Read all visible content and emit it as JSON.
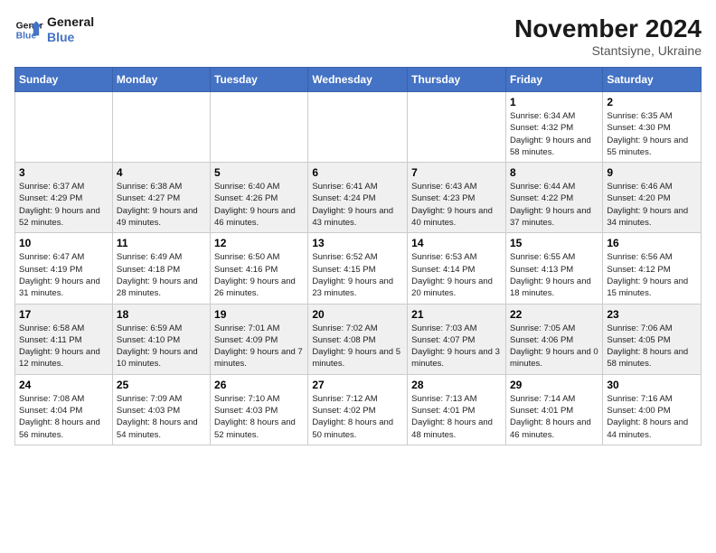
{
  "logo": {
    "line1": "General",
    "line2": "Blue"
  },
  "title": {
    "month_year": "November 2024",
    "location": "Stantsiyne, Ukraine"
  },
  "days_of_week": [
    "Sunday",
    "Monday",
    "Tuesday",
    "Wednesday",
    "Thursday",
    "Friday",
    "Saturday"
  ],
  "weeks": [
    [
      {
        "day": "",
        "info": ""
      },
      {
        "day": "",
        "info": ""
      },
      {
        "day": "",
        "info": ""
      },
      {
        "day": "",
        "info": ""
      },
      {
        "day": "",
        "info": ""
      },
      {
        "day": "1",
        "info": "Sunrise: 6:34 AM\nSunset: 4:32 PM\nDaylight: 9 hours and 58 minutes."
      },
      {
        "day": "2",
        "info": "Sunrise: 6:35 AM\nSunset: 4:30 PM\nDaylight: 9 hours and 55 minutes."
      }
    ],
    [
      {
        "day": "3",
        "info": "Sunrise: 6:37 AM\nSunset: 4:29 PM\nDaylight: 9 hours and 52 minutes."
      },
      {
        "day": "4",
        "info": "Sunrise: 6:38 AM\nSunset: 4:27 PM\nDaylight: 9 hours and 49 minutes."
      },
      {
        "day": "5",
        "info": "Sunrise: 6:40 AM\nSunset: 4:26 PM\nDaylight: 9 hours and 46 minutes."
      },
      {
        "day": "6",
        "info": "Sunrise: 6:41 AM\nSunset: 4:24 PM\nDaylight: 9 hours and 43 minutes."
      },
      {
        "day": "7",
        "info": "Sunrise: 6:43 AM\nSunset: 4:23 PM\nDaylight: 9 hours and 40 minutes."
      },
      {
        "day": "8",
        "info": "Sunrise: 6:44 AM\nSunset: 4:22 PM\nDaylight: 9 hours and 37 minutes."
      },
      {
        "day": "9",
        "info": "Sunrise: 6:46 AM\nSunset: 4:20 PM\nDaylight: 9 hours and 34 minutes."
      }
    ],
    [
      {
        "day": "10",
        "info": "Sunrise: 6:47 AM\nSunset: 4:19 PM\nDaylight: 9 hours and 31 minutes."
      },
      {
        "day": "11",
        "info": "Sunrise: 6:49 AM\nSunset: 4:18 PM\nDaylight: 9 hours and 28 minutes."
      },
      {
        "day": "12",
        "info": "Sunrise: 6:50 AM\nSunset: 4:16 PM\nDaylight: 9 hours and 26 minutes."
      },
      {
        "day": "13",
        "info": "Sunrise: 6:52 AM\nSunset: 4:15 PM\nDaylight: 9 hours and 23 minutes."
      },
      {
        "day": "14",
        "info": "Sunrise: 6:53 AM\nSunset: 4:14 PM\nDaylight: 9 hours and 20 minutes."
      },
      {
        "day": "15",
        "info": "Sunrise: 6:55 AM\nSunset: 4:13 PM\nDaylight: 9 hours and 18 minutes."
      },
      {
        "day": "16",
        "info": "Sunrise: 6:56 AM\nSunset: 4:12 PM\nDaylight: 9 hours and 15 minutes."
      }
    ],
    [
      {
        "day": "17",
        "info": "Sunrise: 6:58 AM\nSunset: 4:11 PM\nDaylight: 9 hours and 12 minutes."
      },
      {
        "day": "18",
        "info": "Sunrise: 6:59 AM\nSunset: 4:10 PM\nDaylight: 9 hours and 10 minutes."
      },
      {
        "day": "19",
        "info": "Sunrise: 7:01 AM\nSunset: 4:09 PM\nDaylight: 9 hours and 7 minutes."
      },
      {
        "day": "20",
        "info": "Sunrise: 7:02 AM\nSunset: 4:08 PM\nDaylight: 9 hours and 5 minutes."
      },
      {
        "day": "21",
        "info": "Sunrise: 7:03 AM\nSunset: 4:07 PM\nDaylight: 9 hours and 3 minutes."
      },
      {
        "day": "22",
        "info": "Sunrise: 7:05 AM\nSunset: 4:06 PM\nDaylight: 9 hours and 0 minutes."
      },
      {
        "day": "23",
        "info": "Sunrise: 7:06 AM\nSunset: 4:05 PM\nDaylight: 8 hours and 58 minutes."
      }
    ],
    [
      {
        "day": "24",
        "info": "Sunrise: 7:08 AM\nSunset: 4:04 PM\nDaylight: 8 hours and 56 minutes."
      },
      {
        "day": "25",
        "info": "Sunrise: 7:09 AM\nSunset: 4:03 PM\nDaylight: 8 hours and 54 minutes."
      },
      {
        "day": "26",
        "info": "Sunrise: 7:10 AM\nSunset: 4:03 PM\nDaylight: 8 hours and 52 minutes."
      },
      {
        "day": "27",
        "info": "Sunrise: 7:12 AM\nSunset: 4:02 PM\nDaylight: 8 hours and 50 minutes."
      },
      {
        "day": "28",
        "info": "Sunrise: 7:13 AM\nSunset: 4:01 PM\nDaylight: 8 hours and 48 minutes."
      },
      {
        "day": "29",
        "info": "Sunrise: 7:14 AM\nSunset: 4:01 PM\nDaylight: 8 hours and 46 minutes."
      },
      {
        "day": "30",
        "info": "Sunrise: 7:16 AM\nSunset: 4:00 PM\nDaylight: 8 hours and 44 minutes."
      }
    ]
  ]
}
